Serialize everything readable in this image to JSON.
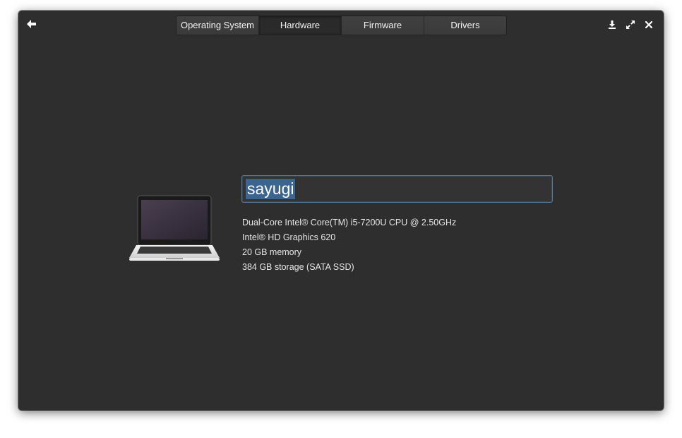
{
  "toolbar": {
    "back_icon": "arrow-left-icon",
    "download_icon": "download-icon",
    "maximize_icon": "maximize-icon",
    "close_icon": "close-icon"
  },
  "tabs": [
    {
      "label": "Operating System",
      "active": false
    },
    {
      "label": "Hardware",
      "active": true
    },
    {
      "label": "Firmware",
      "active": false
    },
    {
      "label": "Drivers",
      "active": false
    }
  ],
  "device": {
    "icon": "laptop-icon",
    "hostname": "sayugi"
  },
  "specs": {
    "cpu": "Dual-Core Intel® Core(TM) i5-7200U CPU @ 2.50GHz",
    "graphics": "Intel® HD Graphics 620",
    "memory": "20 GB memory",
    "storage": "384 GB storage (SATA SSD)"
  },
  "colors": {
    "window_bg": "#2e2e2e",
    "accent_selection": "#3b6590",
    "focus_border": "#56789a",
    "text": "#e6e6e6"
  }
}
